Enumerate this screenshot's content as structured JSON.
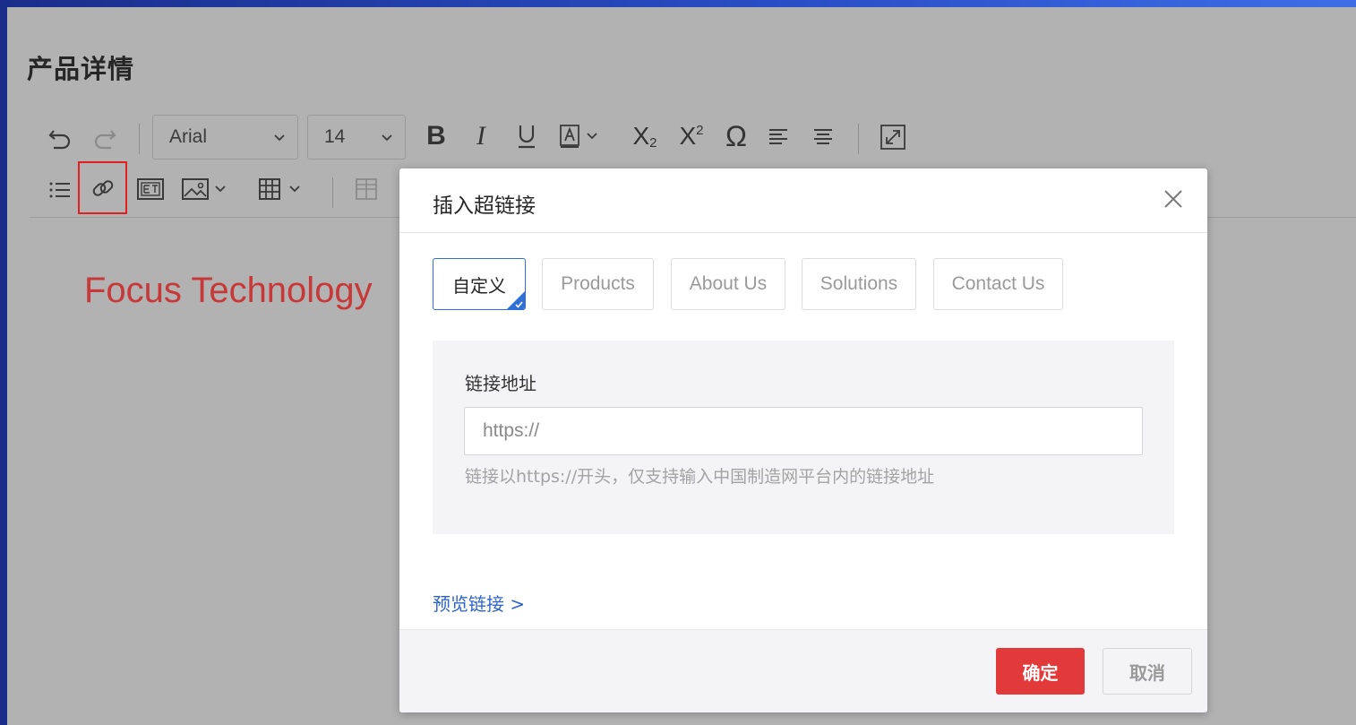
{
  "page": {
    "title": "产品详情"
  },
  "toolbar": {
    "font_family": "Arial",
    "font_size": "14",
    "icons": [
      "undo-icon",
      "redo-icon",
      "bold-icon",
      "italic-icon",
      "underline-icon",
      "font-color-icon",
      "subscript-icon",
      "superscript-icon",
      "special-char-icon",
      "align-left-icon",
      "align-center-icon",
      "fullscreen-icon",
      "list-icon",
      "link-icon",
      "text-box-icon",
      "image-icon",
      "table-icon",
      "table-cell-icon"
    ],
    "highlight_color": "#e02020"
  },
  "editor": {
    "content": "Focus Technology",
    "content_color": "#c93838"
  },
  "dialog": {
    "title": "插入超链接",
    "tabs": [
      {
        "label": "自定义",
        "active": true
      },
      {
        "label": "Products",
        "active": false
      },
      {
        "label": "About Us",
        "active": false
      },
      {
        "label": "Solutions",
        "active": false
      },
      {
        "label": "Contact Us",
        "active": false
      }
    ],
    "field": {
      "label": "链接地址",
      "placeholder": "https://",
      "hint": "链接以https://开头，仅支持输入中国制造网平台内的链接地址"
    },
    "preview_link": "预览链接 >",
    "buttons": {
      "confirm": "确定",
      "cancel": "取消"
    },
    "accent_color": "#2f6fd6",
    "confirm_color": "#e23a3a"
  }
}
